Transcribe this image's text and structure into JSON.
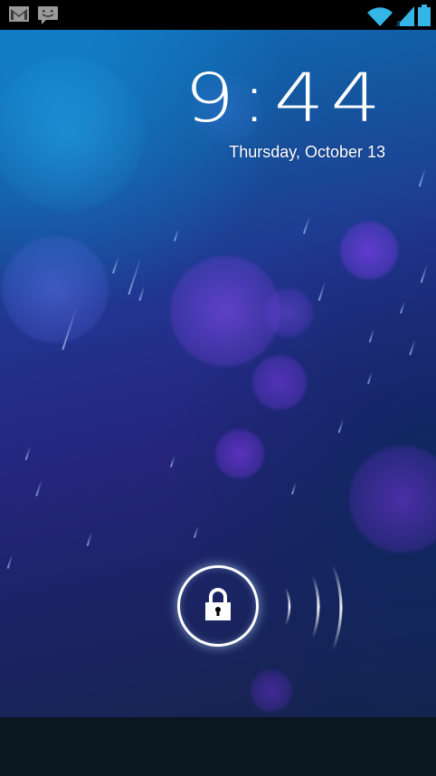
{
  "status_bar": {
    "left_icons": [
      "gmail-icon",
      "message-icon"
    ],
    "right_icons": [
      "wifi-icon",
      "signal-icon",
      "battery-icon"
    ],
    "accent_color": "#33b5e5"
  },
  "lock_screen": {
    "time": "9:44",
    "date": "Thursday, October 13",
    "unlock_icon": "lock-icon"
  },
  "colors": {
    "text": "#ffffff",
    "status_bar_bg": "#000000",
    "bottom_bar_bg": "#0b1720"
  }
}
